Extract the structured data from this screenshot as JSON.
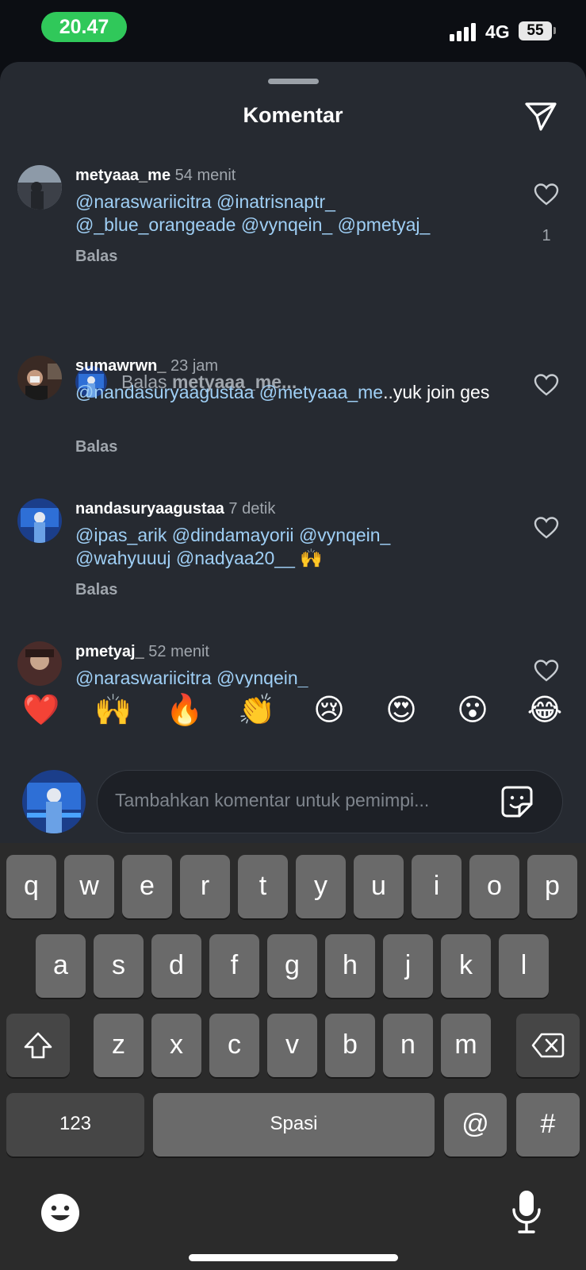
{
  "status_bar": {
    "time": "20.47",
    "network": "4G",
    "battery": "55"
  },
  "sheet": {
    "title": "Komentar"
  },
  "comments": [
    {
      "username": "metyaaa_me",
      "time": "54 menit",
      "text_parts": [
        "@naraswariicitra",
        "@inatrisnaptr_",
        "@_blue_orangeade",
        "@vynqein_",
        "@pmetyaj_"
      ],
      "reply_label": "Balas",
      "likes": "1"
    },
    {
      "username": "sumawrwn_",
      "time": "23 jam",
      "text_parts": [
        "@nandasuryaagustaa",
        "@metyaaa_me",
        "..yuk join ges"
      ],
      "reply_label": "Balas"
    },
    {
      "username": "nandasuryaagustaa",
      "time": "7 detik",
      "text_parts": [
        "@ipas_arik",
        "@dindamayorii",
        "@vynqein_",
        "@wahyuuuj",
        "@nadyaa20__",
        "🙌"
      ],
      "reply_label": "Balas"
    },
    {
      "username": "pmetyaj_",
      "time": "52 menit",
      "text_parts": [
        "@naraswariicitra",
        "@vynqein_"
      ]
    }
  ],
  "reply_prompt": {
    "prefix": "Balas",
    "target": "metyaaa_me..."
  },
  "emoji_bar": [
    "❤️",
    "🙌",
    "🔥",
    "👏",
    "😢",
    "😍",
    "😮",
    "😂"
  ],
  "composer": {
    "placeholder": "Tambahkan komentar untuk pemimpi..."
  },
  "keyboard": {
    "row1": [
      "q",
      "w",
      "e",
      "r",
      "t",
      "y",
      "u",
      "i",
      "o",
      "p"
    ],
    "row2": [
      "a",
      "s",
      "d",
      "f",
      "g",
      "h",
      "j",
      "k",
      "l"
    ],
    "row3": [
      "z",
      "x",
      "c",
      "v",
      "b",
      "n",
      "m"
    ],
    "numbers_key": "123",
    "space_key": "Spasi",
    "at_key": "@",
    "hash_key": "#"
  },
  "colors": {
    "accent_status": "#30c85a",
    "mention": "#9fcff5",
    "sheet_bg": "#262a31"
  },
  "icons": [
    "signal-icon",
    "battery-icon",
    "send-icon",
    "heart-icon",
    "sticker-icon",
    "shift-icon",
    "backspace-icon",
    "emoji-keyboard-icon",
    "microphone-icon"
  ]
}
